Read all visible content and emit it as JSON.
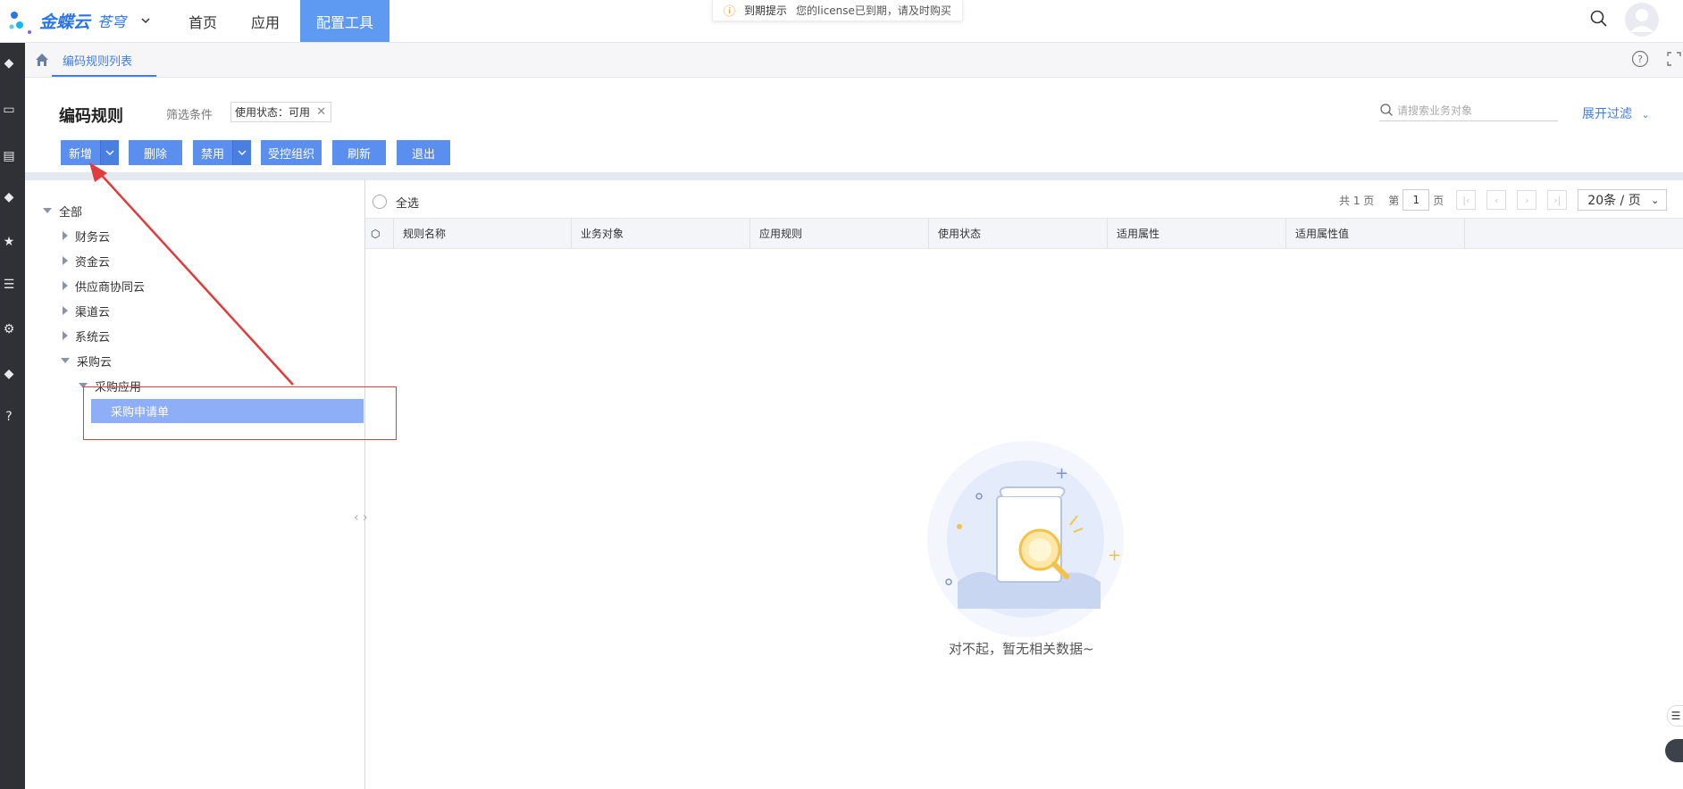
{
  "app": {
    "logo_text": "金蝶云",
    "logo_sub": "苍穹",
    "nav": [
      "首页",
      "应用",
      "配置工具"
    ],
    "active_nav": "配置工具"
  },
  "toast": {
    "title": "到期提示",
    "message": "您的license已到期，请及时购买"
  },
  "tabs": [
    {
      "label": "编码规则列表"
    }
  ],
  "header": {
    "title": "编码规则",
    "filter_label": "筛选条件",
    "filter_chip": "使用状态：可用",
    "search_placeholder": "请搜索业务对象",
    "expand_filter": "展开过滤"
  },
  "toolbar": {
    "new": "新增",
    "delete": "删除",
    "disable": "禁用",
    "controlled_org": "受控组织",
    "refresh": "刷新",
    "exit": "退出"
  },
  "tree": {
    "root": "全部",
    "items": [
      "财务云",
      "资金云",
      "供应商协同云",
      "渠道云",
      "系统云",
      "采购云"
    ],
    "sub": "采购应用",
    "selected": "采购申请单"
  },
  "table": {
    "select_all": "全选",
    "columns": [
      "规则名称",
      "业务对象",
      "应用规则",
      "使用状态",
      "适用属性",
      "适用属性值"
    ],
    "empty_text": "对不起，暂无相关数据~"
  },
  "pager": {
    "total": "共 1 页",
    "page_prefix": "第",
    "page_value": "1",
    "page_suffix": "页",
    "page_size": "20条 / 页"
  },
  "colors": {
    "accent": "#5b8fef",
    "annotation_red": "#e23b3b"
  }
}
